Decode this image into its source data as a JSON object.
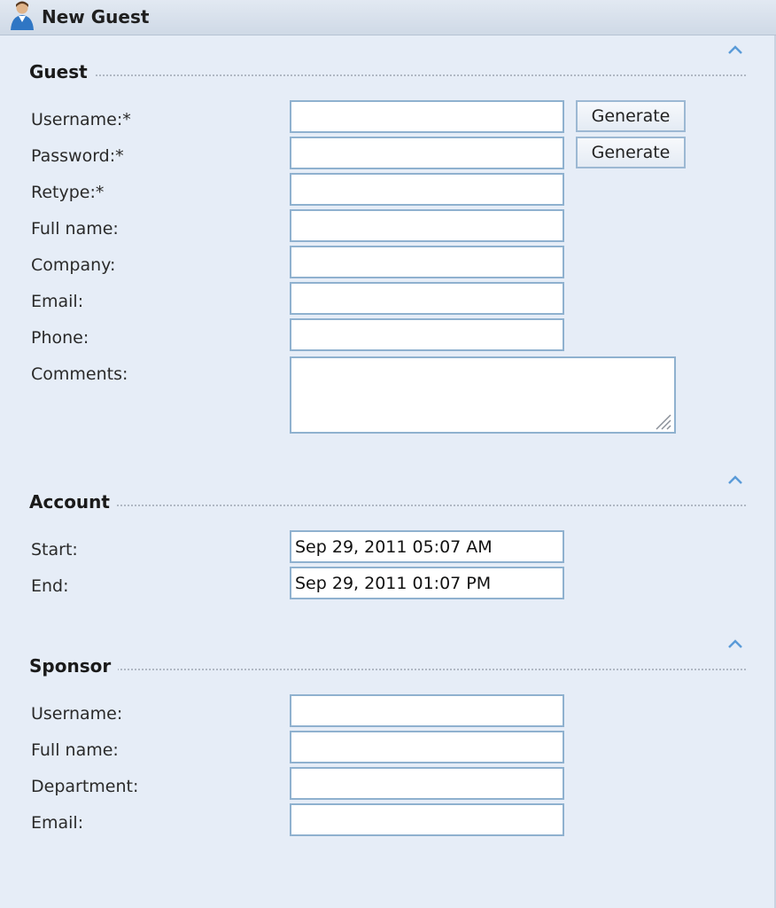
{
  "window": {
    "title": "New Guest",
    "icon": "guest-user-icon"
  },
  "sections": {
    "guest": {
      "title": "Guest",
      "collapse_icon": "chevron-up-icon",
      "username_label": "Username:*",
      "password_label": "Password:*",
      "retype_label": "Retype:*",
      "fullname_label": "Full name:",
      "company_label": "Company:",
      "email_label": "Email:",
      "phone_label": "Phone:",
      "comments_label": "Comments:",
      "generate_label": "Generate",
      "username_value": "",
      "password_value": "",
      "retype_value": "",
      "fullname_value": "",
      "company_value": "",
      "email_value": "",
      "phone_value": "",
      "comments_value": ""
    },
    "account": {
      "title": "Account",
      "collapse_icon": "chevron-up-icon",
      "start_label": "Start:",
      "end_label": "End:",
      "start_value": "Sep 29, 2011 05:07 AM",
      "end_value": "Sep 29, 2011 01:07 PM"
    },
    "sponsor": {
      "title": "Sponsor",
      "collapse_icon": "chevron-up-icon",
      "username_label": "Username:",
      "fullname_label": "Full name:",
      "department_label": "Department:",
      "email_label": "Email:",
      "username_value": "",
      "fullname_value": "",
      "department_value": "",
      "email_value": ""
    }
  },
  "colors": {
    "background": "#e6edf7",
    "field_border": "#8fb1cf",
    "chevron": "#5a9bd8"
  }
}
